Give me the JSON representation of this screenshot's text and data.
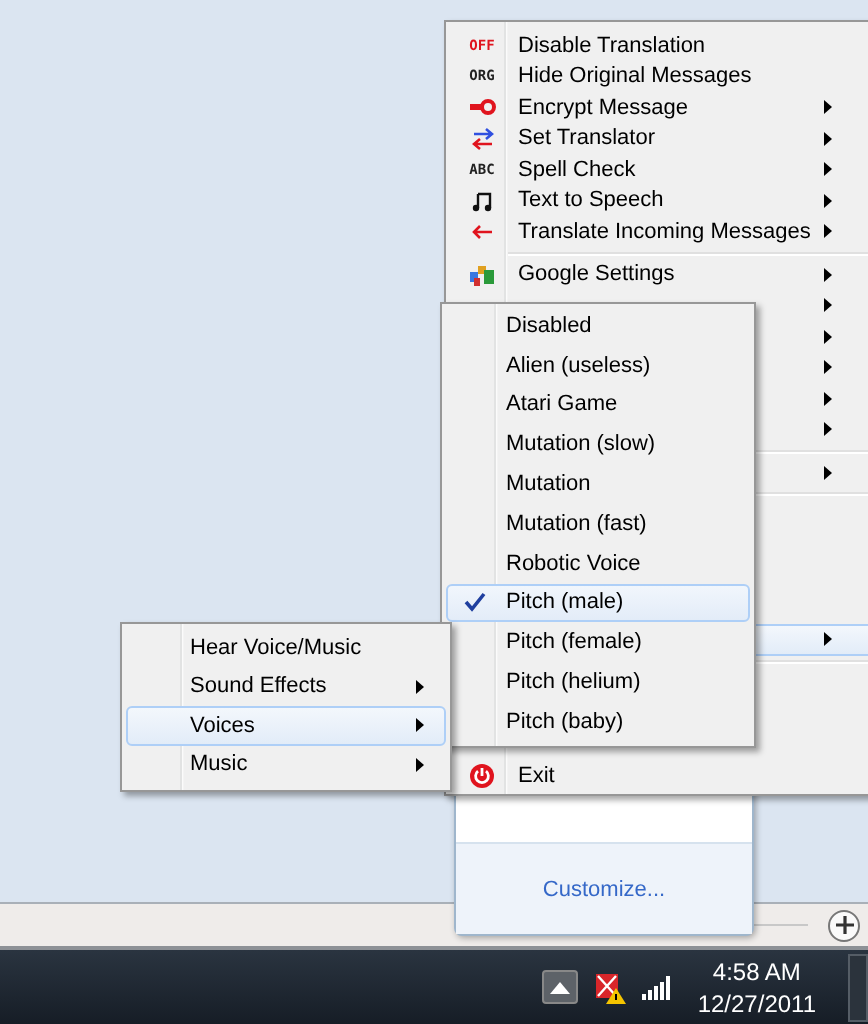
{
  "main_menu": {
    "items": [
      {
        "kind": "item",
        "label": "Disable Translation",
        "icon_text": "OFF",
        "has_submenu": false,
        "selected": false
      },
      {
        "kind": "item",
        "label": "Hide Original Messages",
        "icon_text": "ORG",
        "has_submenu": false,
        "selected": false
      },
      {
        "kind": "item",
        "label": "Encrypt Message",
        "has_submenu": true,
        "selected": false
      },
      {
        "kind": "item",
        "label": "Set Translator",
        "has_submenu": true,
        "selected": false
      },
      {
        "kind": "item",
        "label": "Spell Check",
        "icon_text": "ABC",
        "has_submenu": true,
        "selected": false
      },
      {
        "kind": "item",
        "label": "Text to Speech",
        "has_submenu": true,
        "selected": false
      },
      {
        "kind": "item",
        "label": "Translate Incoming Messages",
        "has_submenu": true,
        "selected": false
      },
      {
        "kind": "separator"
      },
      {
        "kind": "item",
        "label": "Google Settings",
        "has_submenu": true,
        "selected": false
      },
      {
        "kind": "item",
        "has_submenu": true,
        "selected": false
      },
      {
        "kind": "item",
        "has_submenu": true,
        "selected": false
      },
      {
        "kind": "item",
        "has_submenu": true,
        "selected": false
      },
      {
        "kind": "item",
        "has_submenu": true,
        "selected": false
      },
      {
        "kind": "item",
        "has_submenu": true,
        "selected": false
      },
      {
        "kind": "separator"
      },
      {
        "kind": "item",
        "has_submenu": true,
        "selected": false
      },
      {
        "kind": "separator"
      },
      {
        "kind": "item",
        "has_submenu": false,
        "selected": false
      },
      {
        "kind": "item",
        "has_submenu": false,
        "selected": false
      },
      {
        "kind": "item",
        "has_submenu": false,
        "selected": false
      },
      {
        "kind": "item",
        "has_submenu": false,
        "selected": false
      },
      {
        "kind": "item",
        "has_submenu": true,
        "selected": true
      },
      {
        "kind": "separator"
      },
      {
        "kind": "item",
        "has_submenu": false,
        "selected": false
      },
      {
        "kind": "item",
        "has_submenu": false,
        "selected": false
      },
      {
        "kind": "item",
        "has_submenu": false,
        "selected": false
      },
      {
        "kind": "item",
        "label": "Exit",
        "has_submenu": false,
        "selected": false
      }
    ]
  },
  "voices_menu": {
    "items": [
      {
        "label": "Disabled",
        "checked": false
      },
      {
        "label": "Alien (useless)",
        "checked": false
      },
      {
        "label": "Atari Game",
        "checked": false
      },
      {
        "label": "Mutation (slow)",
        "checked": false
      },
      {
        "label": "Mutation",
        "checked": false
      },
      {
        "label": "Mutation (fast)",
        "checked": false
      },
      {
        "label": "Robotic Voice",
        "checked": false
      },
      {
        "label": "Pitch (male)",
        "checked": true
      },
      {
        "label": "Pitch (female)",
        "checked": false
      },
      {
        "label": "Pitch (helium)",
        "checked": false
      },
      {
        "label": "Pitch (baby)",
        "checked": false
      }
    ]
  },
  "sound_menu": {
    "items": [
      {
        "label": "Hear Voice/Music",
        "has_submenu": false,
        "selected": false
      },
      {
        "label": "Sound Effects",
        "has_submenu": true,
        "selected": false
      },
      {
        "label": "Voices",
        "has_submenu": true,
        "selected": true
      },
      {
        "label": "Music",
        "has_submenu": true,
        "selected": false
      }
    ]
  },
  "tray_popup": {
    "link": "Customize..."
  },
  "taskbar": {
    "time": "4:58 AM",
    "date": "12/27/2011"
  }
}
